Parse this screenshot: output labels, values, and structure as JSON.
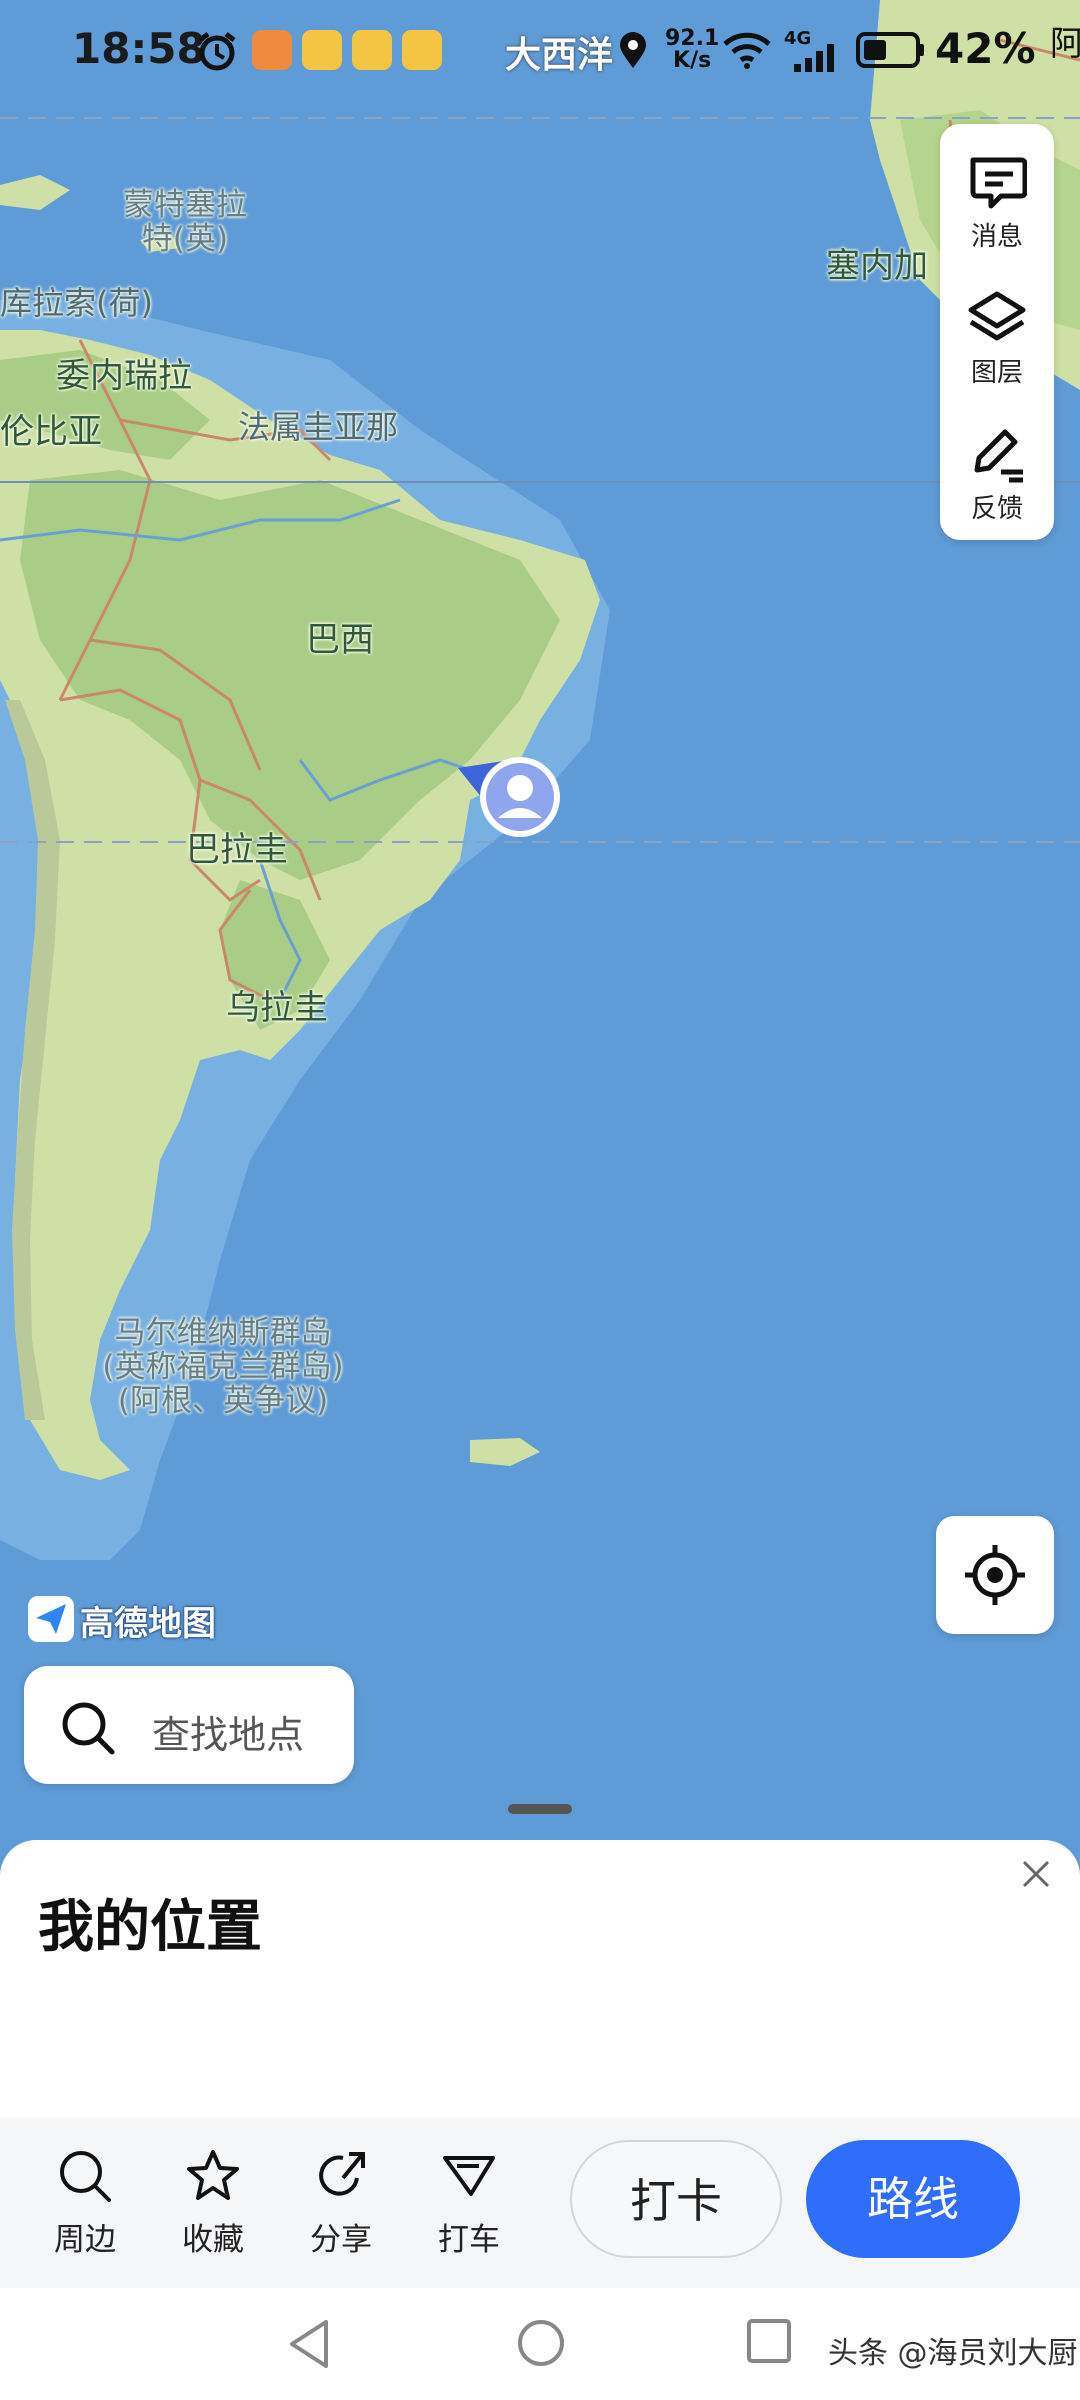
{
  "status_bar": {
    "time": "18:58",
    "location_text": "大西洋",
    "speed_value": "92.1",
    "speed_unit": "K/s",
    "network": "4G",
    "battery_percent": "42%",
    "edge_label": "阿"
  },
  "map": {
    "labels": {
      "montserrat": "蒙特塞拉特(英)",
      "curacao": "库拉索(荷)",
      "venezuela": "委内瑞拉",
      "colombia": "伦比亚",
      "french_guiana": "法属圭亚那",
      "brazil": "巴西",
      "paraguay": "巴拉圭",
      "uruguay": "乌拉圭",
      "falklands": "马尔维纳斯群岛(英称福克兰群岛)(阿根、英争议)",
      "senegal": "塞内加"
    },
    "colors": {
      "ocean": "#5f9bd6",
      "land": "#cfe0a6",
      "forest": "#a9cd86",
      "border": "#c9876b",
      "accent": "#2f6dfb"
    }
  },
  "toolbar": {
    "messages_label": "消息",
    "layers_label": "图层",
    "feedback_label": "反馈"
  },
  "brand": {
    "logo_text": "高德地图"
  },
  "search": {
    "placeholder": "查找地点"
  },
  "sheet": {
    "title": "我的位置",
    "actions": [
      {
        "label": "周边",
        "icon": "search-icon"
      },
      {
        "label": "收藏",
        "icon": "star-icon"
      },
      {
        "label": "分享",
        "icon": "share-icon"
      },
      {
        "label": "打车",
        "icon": "taxi-icon"
      }
    ],
    "checkin_label": "打卡",
    "route_label": "路线"
  },
  "watermark": "头条 @海员刘大厨"
}
